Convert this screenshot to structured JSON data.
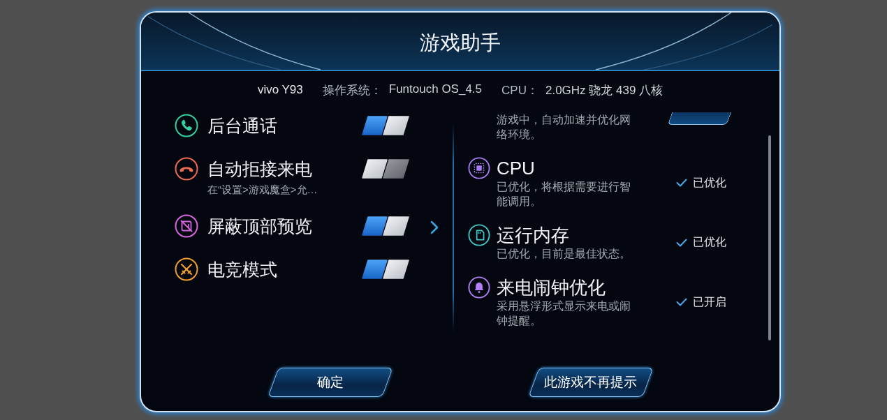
{
  "dialog": {
    "title": "游戏助手"
  },
  "device_info": {
    "model": "vivo Y93",
    "os_label": "操作系统：",
    "os_value": "Funtouch OS_4.5",
    "cpu_label": "CPU：",
    "cpu_value": "2.0GHz 骁龙 439 八核"
  },
  "left_panel": {
    "items": [
      {
        "label": "后台通话",
        "on": true,
        "color": "#35d0a0"
      },
      {
        "label": "自动拒接来电",
        "subtitle": "在“设置>游戏魔盒>允…",
        "on": false,
        "color": "#f06a52"
      },
      {
        "label": "屏蔽顶部预览",
        "on": true,
        "color": "#d866e0"
      },
      {
        "label": "电竞模式",
        "on": true,
        "color": "#f0a030"
      }
    ]
  },
  "right_panel": {
    "items": [
      {
        "description": "游戏中，自动加速并优化网络环境。",
        "status": {
          "kind": "button"
        }
      },
      {
        "title": "CPU",
        "description": "已优化，将根据需要进行智能调用。",
        "color": "#a77cf0",
        "status": {
          "kind": "check",
          "text": "已优化"
        }
      },
      {
        "title": "运行内存",
        "description": "已优化，目前是最佳状态。",
        "color": "#3ec8c8",
        "status": {
          "kind": "check",
          "text": "已优化"
        }
      },
      {
        "title": "来电闹钟优化",
        "description": "采用悬浮形式显示来电或闹钟提醒。",
        "color": "#b27ff5",
        "status": {
          "kind": "check",
          "text": "已开启"
        }
      }
    ]
  },
  "buttons": [
    {
      "label": "确定"
    },
    {
      "label": "此游戏不再提示"
    }
  ]
}
